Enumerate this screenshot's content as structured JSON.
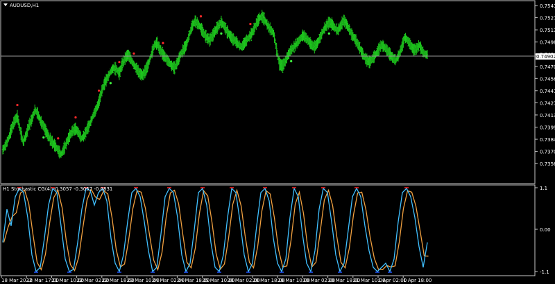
{
  "main_chart": {
    "title": "AUDUSD,H1",
    "current_price": "0.74902",
    "price_axis_labels": [
      "0.75415",
      "0.75270",
      "0.75130",
      "0.74985",
      "0.74845",
      "0.74700",
      "0.74560",
      "0.74415",
      "0.74275",
      "0.74130",
      "0.73990",
      "0.73845",
      "0.73705",
      "0.73560"
    ]
  },
  "indicator": {
    "title": "H1 Stochastic CG(4) -0.3057 -0.3057 -0.0831",
    "axis_labels": [
      "1.1",
      "0.00",
      "-1.1"
    ]
  },
  "time_axis_labels": [
    "18 Mar 2022",
    "18 Mar 17:00",
    "21 Mar 10:00",
    "22 Mar 02:00",
    "22 Mar 18:00",
    "23 Mar 10:00",
    "24 Mar 02:00",
    "24 Mar 18:00",
    "25 Mar 10:00",
    "28 Mar 02:00",
    "28 Mar 18:00",
    "29 Mar 10:00",
    "30 Mar 02:00",
    "30 Mar 18:00",
    "31 Mar 10:00",
    "1 Apr 02:00",
    "1 Apr 18:00"
  ],
  "colors": {
    "background": "#000000",
    "bars": "#1ec81e",
    "signal_high": "#ff2a2a",
    "signal_low": "#44ff44",
    "line_orange": "#f0a040",
    "line_blue": "#40c0ff",
    "marker_red": "#ff2020",
    "marker_blue": "#2050ff",
    "border": "#c8c8c8"
  },
  "chart_data": {
    "type": "bar",
    "series": [
      {
        "values": [
          0.739,
          0.7395,
          0.7402,
          0.7412,
          0.742,
          0.7425,
          0.741,
          0.7398,
          0.7405,
          0.7416,
          0.7422,
          0.7432,
          0.7428,
          0.742,
          0.7415,
          0.7408,
          0.7402,
          0.7398,
          0.7394,
          0.739,
          0.7385,
          0.7391,
          0.7398,
          0.7405,
          0.741,
          0.7412,
          0.7408,
          0.7402,
          0.7405,
          0.7412,
          0.7418,
          0.7426,
          0.7432,
          0.744,
          0.7452,
          0.746,
          0.7466,
          0.7472,
          0.7476,
          0.7475,
          0.747,
          0.748,
          0.7486,
          0.749,
          0.7485,
          0.7479,
          0.7475,
          0.747,
          0.7468,
          0.7473,
          0.748,
          0.749,
          0.75,
          0.7502,
          0.7495,
          0.749,
          0.7486,
          0.7482,
          0.7478,
          0.7476,
          0.7482,
          0.749,
          0.7495,
          0.75,
          0.751,
          0.752,
          0.7525,
          0.7522,
          0.7518,
          0.7512,
          0.7508,
          0.7505,
          0.751,
          0.7515,
          0.752,
          0.7524,
          0.752,
          0.7514,
          0.751,
          0.7506,
          0.7504,
          0.75,
          0.7498,
          0.7502,
          0.7506,
          0.751,
          0.7515,
          0.7522,
          0.7528,
          0.753,
          0.7526,
          0.752,
          0.7516,
          0.7512,
          0.7495,
          0.748,
          0.7478,
          0.7483,
          0.749,
          0.7495,
          0.7498,
          0.7502,
          0.7506,
          0.751,
          0.7508,
          0.7504,
          0.75,
          0.7498,
          0.7502,
          0.7508,
          0.7515,
          0.752,
          0.7524,
          0.7522,
          0.7518,
          0.7515,
          0.752,
          0.7526,
          0.7522,
          0.7516,
          0.751,
          0.7506,
          0.75,
          0.7494,
          0.7488,
          0.7484,
          0.7482,
          0.7486,
          0.749,
          0.7495,
          0.75,
          0.7498,
          0.7494,
          0.749,
          0.7486,
          0.7484,
          0.749,
          0.7498,
          0.7508,
          0.7505,
          0.75,
          0.7495,
          0.7496,
          0.75,
          0.7494,
          0.749
        ]
      },
      {
        "name": "Stochastic CG(4)",
        "values": [
          -0.3,
          0.5,
          0.1,
          0.8,
          1.0,
          0.9,
          0.3,
          -0.6,
          -1.0,
          -0.9,
          -0.2,
          0.6,
          1.0,
          0.9,
          0.1,
          -0.7,
          -1.0,
          -0.95,
          -0.3,
          0.5,
          1.0,
          0.95,
          0.6,
          0.9,
          1.0,
          0.7,
          -0.2,
          -0.8,
          -1.0,
          -0.6,
          0.2,
          0.9,
          1.0,
          0.8,
          0.2,
          -0.5,
          -1.0,
          -0.9,
          -0.1,
          0.8,
          1.0,
          0.9,
          0.3,
          -0.6,
          -1.0,
          -0.8,
          0.0,
          0.9,
          1.0,
          0.6,
          -0.3,
          -0.9,
          -1.0,
          -0.6,
          0.3,
          1.0,
          0.9,
          0.2,
          -0.6,
          -1.0,
          -0.8,
          0.1,
          0.9,
          1.0,
          0.7,
          -0.2,
          -0.8,
          -1.0,
          -0.7,
          0.3,
          1.0,
          0.8,
          -0.1,
          -0.8,
          -1.0,
          -0.5,
          0.5,
          1.0,
          0.9,
          0.2,
          -0.6,
          -1.0,
          -0.8,
          0.0,
          0.8,
          1.0,
          0.8,
          0.1,
          -0.5,
          -0.9,
          -1.0,
          -0.9,
          -0.8,
          -1.0,
          -0.7,
          0.2,
          0.9,
          1.0,
          0.8,
          0.3,
          -0.4,
          -0.9,
          -0.3
        ]
      }
    ],
    "ylim": [
      0.7356,
      0.7545
    ],
    "grid": false
  }
}
